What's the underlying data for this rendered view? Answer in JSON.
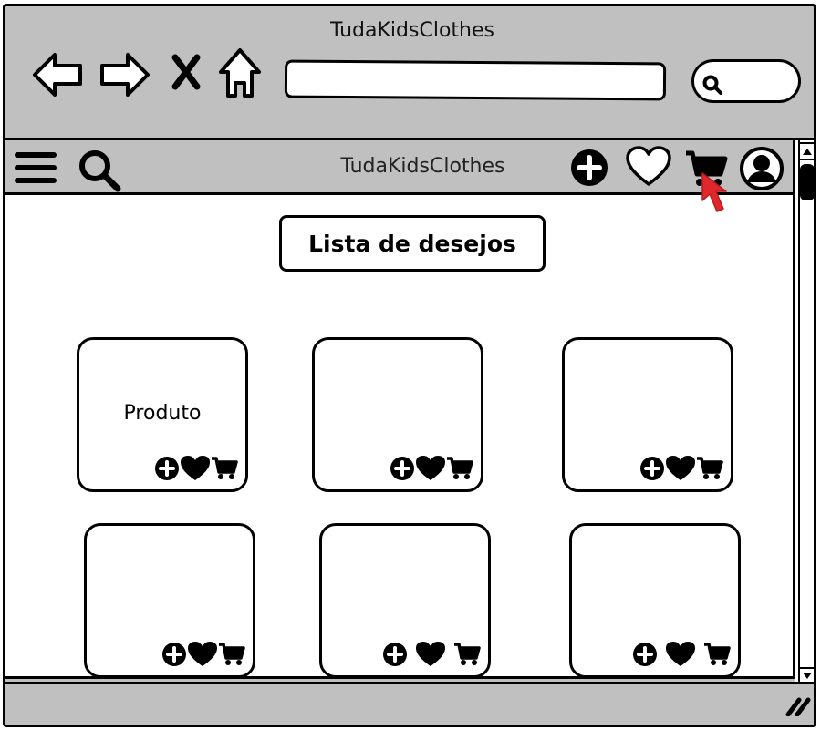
{
  "browser": {
    "window_title": "TudaKidsClothes",
    "back_icon": "arrow-left-icon",
    "forward_icon": "arrow-right-icon",
    "stop_icon": "close-icon",
    "home_icon": "home-icon",
    "url": "",
    "search_icon": "search-icon"
  },
  "app": {
    "title": "TudaKidsClothes",
    "menu_icon": "hamburger-menu-icon",
    "search_icon": "search-icon",
    "add_icon": "plus-circle-icon",
    "wishlist_icon": "heart-outline-icon",
    "cart_icon": "cart-icon",
    "profile_icon": "user-avatar-icon"
  },
  "page": {
    "heading": "Lista de desejos"
  },
  "products": [
    {
      "label": "Produto"
    },
    {
      "label": ""
    },
    {
      "label": ""
    },
    {
      "label": ""
    },
    {
      "label": ""
    },
    {
      "label": ""
    }
  ],
  "colors": {
    "chrome": "#c0c0c0",
    "cursor": "#e0272c"
  }
}
